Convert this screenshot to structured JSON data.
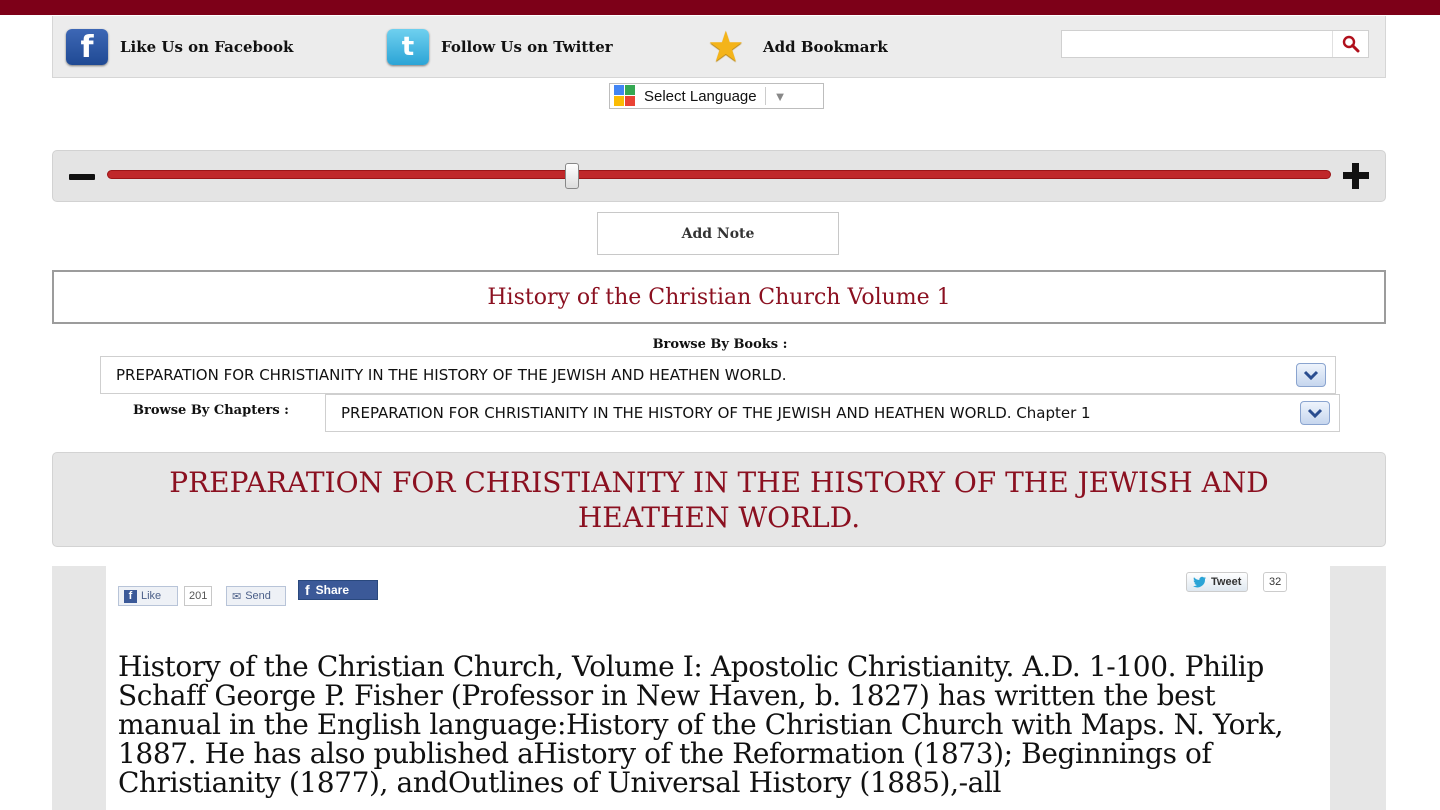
{
  "social": {
    "facebook_label": "Like Us on Facebook",
    "twitter_label": "Follow Us on Twitter",
    "bookmark_label": "Add Bookmark",
    "search_value": "",
    "search_placeholder": ""
  },
  "language": {
    "label": "Select Language"
  },
  "zoom": {
    "level": 0.38
  },
  "add_note_label": "Add Note",
  "book_title": "History of the Christian Church Volume 1",
  "browse": {
    "books_label": "Browse By Books :",
    "books_value": "PREPARATION FOR CHRISTIANITY IN THE HISTORY OF THE JEWISH AND HEATHEN WORLD.",
    "chapters_label": "Browse By Chapters :",
    "chapters_value": "PREPARATION FOR CHRISTIANITY IN THE HISTORY OF THE JEWISH AND HEATHEN WORLD. Chapter 1"
  },
  "section_heading": "PREPARATION FOR CHRISTIANITY IN THE HISTORY OF THE JEWISH AND HEATHEN WORLD.",
  "share": {
    "like_label": "Like",
    "like_count": "201",
    "send_label": "Send",
    "fb_share_label": "Share",
    "tweet_label": "Tweet",
    "tweet_count": "32"
  },
  "body_text": "History of the Christian Church, Volume I: Apostolic Christianity. A.D. 1-100. Philip Schaff George P. Fisher (Professor in New Haven, b. 1827) has written the best manual in the English language:History of the Christian Church with Maps. N. York, 1887. He has also published aHistory of the Reformation (1873); Beginnings of Christianity (1877), andOutlines of Universal History (1885),-all",
  "colors": {
    "brand": "#7d0018",
    "title_red": "#8b1020",
    "slider_red": "#c0282a"
  }
}
